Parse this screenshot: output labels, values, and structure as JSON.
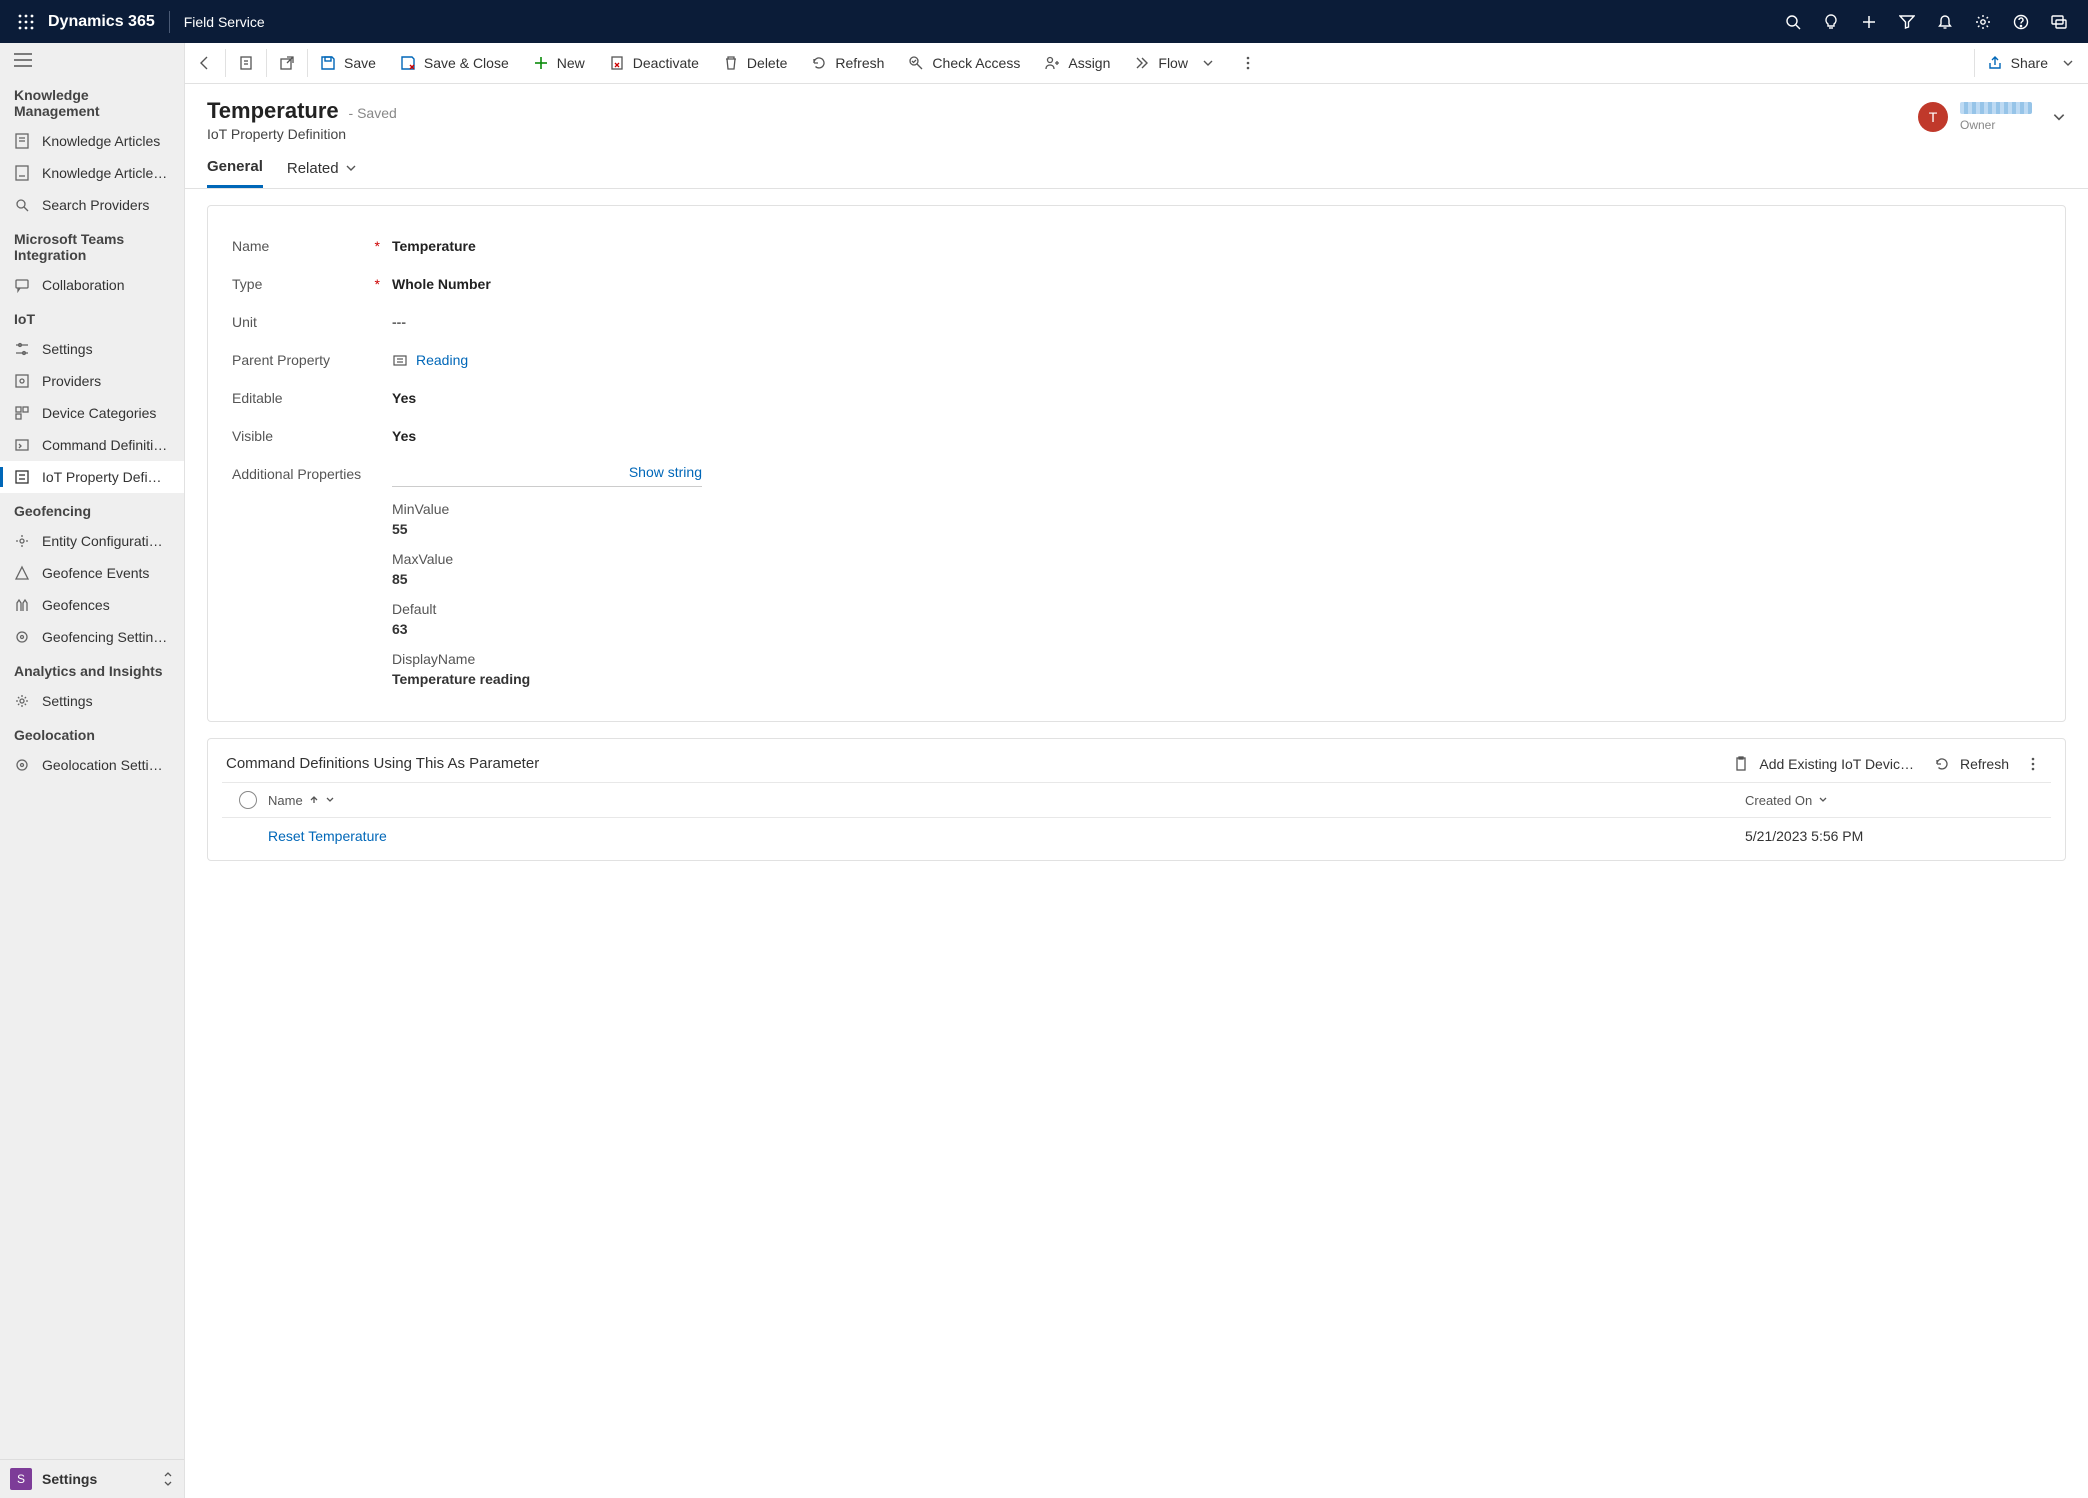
{
  "topnav": {
    "brand": "Dynamics 365",
    "app": "Field Service"
  },
  "cmdbar": {
    "save": "Save",
    "save_close": "Save & Close",
    "new": "New",
    "deactivate": "Deactivate",
    "delete": "Delete",
    "refresh": "Refresh",
    "check_access": "Check Access",
    "assign": "Assign",
    "flow": "Flow",
    "share": "Share"
  },
  "record": {
    "title": "Temperature",
    "saved_tag": "- Saved",
    "entity": "IoT Property Definition",
    "owner_label": "Owner",
    "avatar_initial": "T"
  },
  "tabs": {
    "general": "General",
    "related": "Related"
  },
  "form": {
    "name_label": "Name",
    "name_value": "Temperature",
    "type_label": "Type",
    "type_value": "Whole Number",
    "unit_label": "Unit",
    "unit_value": "---",
    "parent_label": "Parent Property",
    "parent_value": "Reading",
    "editable_label": "Editable",
    "editable_value": "Yes",
    "visible_label": "Visible",
    "visible_value": "Yes",
    "addl_label": "Additional Properties",
    "show_string": "Show string",
    "props": {
      "min_key": "MinValue",
      "min_val": "55",
      "max_key": "MaxValue",
      "max_val": "85",
      "default_key": "Default",
      "default_val": "63",
      "display_key": "DisplayName",
      "display_val": "Temperature reading"
    }
  },
  "subgrid": {
    "title": "Command Definitions Using This As Parameter",
    "add_existing": "Add Existing IoT Devic…",
    "refresh": "Refresh",
    "col_name": "Name",
    "col_created": "Created On",
    "row0_name": "Reset Temperature",
    "row0_created": "5/21/2023 5:56 PM"
  },
  "sidebar": {
    "groups": [
      {
        "title": "Knowledge Management",
        "items": [
          {
            "label": "Knowledge Articles"
          },
          {
            "label": "Knowledge Article…"
          },
          {
            "label": "Search Providers"
          }
        ]
      },
      {
        "title": "Microsoft Teams Integration",
        "items": [
          {
            "label": "Collaboration"
          }
        ]
      },
      {
        "title": "IoT",
        "items": [
          {
            "label": "Settings"
          },
          {
            "label": "Providers"
          },
          {
            "label": "Device Categories"
          },
          {
            "label": "Command Definiti…"
          },
          {
            "label": "IoT Property Defi…",
            "active": true
          }
        ]
      },
      {
        "title": "Geofencing",
        "items": [
          {
            "label": "Entity Configurati…"
          },
          {
            "label": "Geofence Events"
          },
          {
            "label": "Geofences"
          },
          {
            "label": "Geofencing Settin…"
          }
        ]
      },
      {
        "title": "Analytics and Insights",
        "items": [
          {
            "label": "Settings"
          }
        ]
      },
      {
        "title": "Geolocation",
        "items": [
          {
            "label": "Geolocation Setti…"
          }
        ]
      }
    ],
    "footer_badge": "S",
    "footer_label": "Settings"
  }
}
